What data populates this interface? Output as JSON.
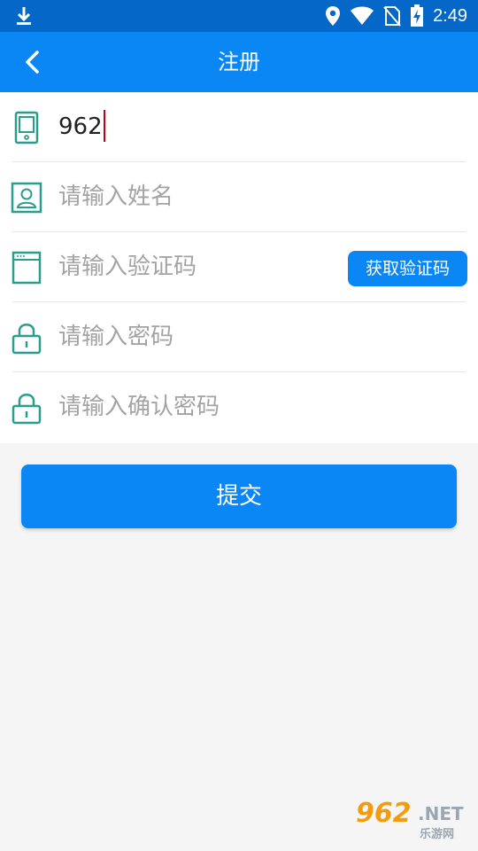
{
  "status_bar": {
    "time": "2:49",
    "icons": [
      "download-icon",
      "location-icon",
      "wifi-icon",
      "no-sim-icon",
      "battery-charging-icon"
    ]
  },
  "app_bar": {
    "back_icon": "chevron-left-icon",
    "title": "注册"
  },
  "form": {
    "phone": {
      "icon": "phone-icon",
      "value": "962"
    },
    "name": {
      "icon": "user-icon",
      "placeholder": "请输入姓名"
    },
    "code": {
      "icon": "window-icon",
      "placeholder": "请输入验证码",
      "get_code_label": "获取验证码"
    },
    "password": {
      "icon": "lock-icon",
      "placeholder": "请输入密码"
    },
    "confirm_password": {
      "icon": "lock-icon",
      "placeholder": "请输入确认密码"
    }
  },
  "submit_label": "提交",
  "watermark": {
    "number": "962",
    "suffix": ".NET",
    "text": "乐游网"
  },
  "colors": {
    "status_bar": "#0567c7",
    "primary": "#0b86f5",
    "icon_teal": "#2a9d8f",
    "background": "#f5f5f5",
    "placeholder": "#a3a3a3",
    "cursor": "#c0001a"
  }
}
